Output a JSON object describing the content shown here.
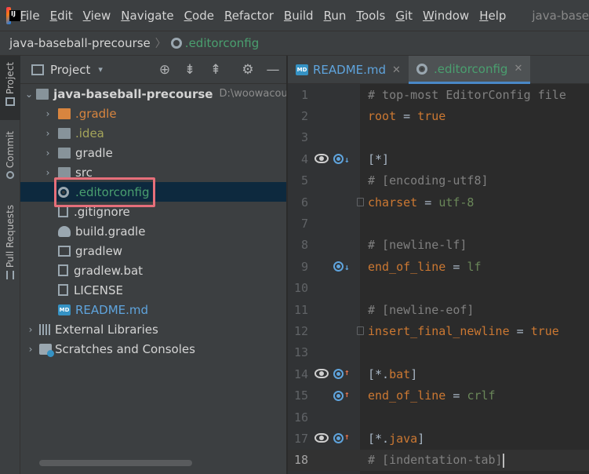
{
  "menubar": {
    "logo_text": "IJ",
    "items": [
      {
        "u": "F",
        "rest": "ile"
      },
      {
        "u": "E",
        "rest": "dit"
      },
      {
        "u": "V",
        "rest": "iew"
      },
      {
        "u": "N",
        "rest": "avigate"
      },
      {
        "u": "C",
        "rest": "ode"
      },
      {
        "u": "R",
        "rest": "efactor"
      },
      {
        "u": "B",
        "rest": "uild"
      },
      {
        "u": "R",
        "rest": "un"
      },
      {
        "u": "T",
        "rest": "ools"
      },
      {
        "u": "G",
        "rest": "it"
      },
      {
        "u": "W",
        "rest": "indow"
      },
      {
        "u": "H",
        "rest": "elp"
      }
    ],
    "window_title": "java-base"
  },
  "breadcrumb": {
    "project": "java-baseball-precourse",
    "separator": "〉",
    "file": ".editorconfig"
  },
  "toolstrip": {
    "project": "Project",
    "commit": "Commit",
    "pull_requests": "Pull Requests"
  },
  "project_panel": {
    "title": "Project",
    "dropdown": "▾",
    "tools": {
      "locate": "⊕",
      "expand": "⇟",
      "collapse": "⇞",
      "settings": "⚙",
      "hide": "—"
    },
    "root": {
      "name": "java-baseball-precourse",
      "path": "D:\\woowacourse"
    },
    "items": [
      {
        "name": ".gradle",
        "type": "folder-orange"
      },
      {
        "name": ".idea",
        "type": "folder"
      },
      {
        "name": "gradle",
        "type": "folder"
      },
      {
        "name": "src",
        "type": "folder"
      },
      {
        "name": ".editorconfig",
        "type": "config",
        "selected": true
      },
      {
        "name": ".gitignore",
        "type": "file"
      },
      {
        "name": "build.gradle",
        "type": "gradle"
      },
      {
        "name": "gradlew",
        "type": "terminal"
      },
      {
        "name": "gradlew.bat",
        "type": "file"
      },
      {
        "name": "LICENSE",
        "type": "file"
      },
      {
        "name": "README.md",
        "type": "md"
      }
    ],
    "external_libraries": "External Libraries",
    "scratches": "Scratches and Consoles"
  },
  "editor": {
    "tabs": [
      {
        "label": "README.md",
        "icon_text": "MD"
      },
      {
        "label": ".editorconfig",
        "active": true
      }
    ],
    "close_glyph": "✕",
    "lines": [
      {
        "n": "1",
        "parts": [
          [
            "# top-most EditorConfig file",
            "k-comment"
          ]
        ]
      },
      {
        "n": "2",
        "parts": [
          [
            "root",
            "k-key"
          ],
          [
            " = ",
            "k-sect"
          ],
          [
            "true",
            "k-true"
          ]
        ]
      },
      {
        "n": "3",
        "parts": []
      },
      {
        "n": "4",
        "parts": [
          [
            "[*]",
            "k-sect"
          ]
        ]
      },
      {
        "n": "5",
        "parts": [
          [
            "# [encoding-utf8]",
            "k-comment"
          ]
        ]
      },
      {
        "n": "6",
        "parts": [
          [
            "charset",
            "k-key"
          ],
          [
            " = ",
            "k-sect"
          ],
          [
            "utf-8",
            "k-val"
          ]
        ]
      },
      {
        "n": "7",
        "parts": []
      },
      {
        "n": "8",
        "parts": [
          [
            "# [newline-lf]",
            "k-comment"
          ]
        ]
      },
      {
        "n": "9",
        "parts": [
          [
            "end_of_line",
            "k-key"
          ],
          [
            " = ",
            "k-sect"
          ],
          [
            "lf",
            "k-val"
          ]
        ]
      },
      {
        "n": "10",
        "parts": []
      },
      {
        "n": "11",
        "parts": [
          [
            "# [newline-eof]",
            "k-comment"
          ]
        ]
      },
      {
        "n": "12",
        "parts": [
          [
            "insert_final_newline",
            "k-key"
          ],
          [
            " = ",
            "k-sect"
          ],
          [
            "true",
            "k-true"
          ]
        ]
      },
      {
        "n": "13",
        "parts": []
      },
      {
        "n": "14",
        "parts": [
          [
            "[*.",
            "k-sect"
          ],
          [
            "bat",
            "k-sect-ext"
          ],
          [
            "]",
            "k-sect"
          ]
        ]
      },
      {
        "n": "15",
        "parts": [
          [
            "end_of_line",
            "k-key"
          ],
          [
            " = ",
            "k-sect"
          ],
          [
            "crlf",
            "k-val"
          ]
        ]
      },
      {
        "n": "16",
        "parts": []
      },
      {
        "n": "17",
        "parts": [
          [
            "[*.",
            "k-sect"
          ],
          [
            "java",
            "k-sect-ext"
          ],
          [
            "]",
            "k-sect"
          ]
        ]
      },
      {
        "n": "18",
        "parts": [
          [
            "# [indentation-tab]",
            "k-comment"
          ]
        ]
      }
    ]
  }
}
